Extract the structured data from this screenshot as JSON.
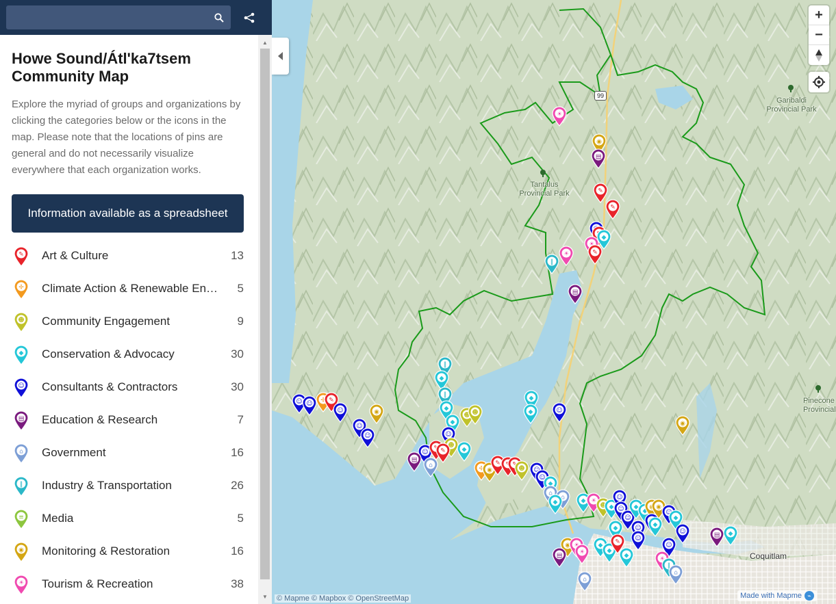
{
  "search": {
    "placeholder": "",
    "value": ""
  },
  "sidebar": {
    "title": "Howe Sound/Átl'ka7tsem Community Map",
    "description": "Explore the myriad of groups and organizations by clicking the categories below or the icons in the map. Please note that the locations of pins are general and do not necessarily visualize everywhere that each organization works.",
    "spreadsheet_button": "Information available as a spreadsheet",
    "categories": [
      {
        "label": "Art & Culture",
        "count": "13",
        "color": "#e8232a",
        "icon": "art-icon"
      },
      {
        "label": "Climate Action & Renewable Energy",
        "count": "5",
        "color": "#f39a1f",
        "icon": "windmill-icon"
      },
      {
        "label": "Community Engagement",
        "count": "9",
        "color": "#c0c22a",
        "icon": "people-icon"
      },
      {
        "label": "Conservation & Advocacy",
        "count": "30",
        "color": "#24c7d8",
        "icon": "fish-icon"
      },
      {
        "label": "Consultants & Contractors",
        "count": "30",
        "color": "#1010d8",
        "icon": "chat-person-icon"
      },
      {
        "label": "Education & Research",
        "count": "7",
        "color": "#7a1a7e",
        "icon": "book-icon"
      },
      {
        "label": "Government",
        "count": "16",
        "color": "#7d9fd6",
        "icon": "building-icon"
      },
      {
        "label": "Industry & Transportation",
        "count": "26",
        "color": "#2bb8c8",
        "icon": "road-icon"
      },
      {
        "label": "Media",
        "count": "5",
        "color": "#8dc63f",
        "icon": "newspaper-icon"
      },
      {
        "label": "Monitoring & Restoration",
        "count": "16",
        "color": "#d4a614",
        "icon": "monitor-icon"
      },
      {
        "label": "Tourism & Recreation",
        "count": "38",
        "color": "#f04ab0",
        "icon": "sunset-icon"
      }
    ]
  },
  "map": {
    "labels": {
      "tantalus": "Tantalus Provincial Park",
      "garibaldi": "Garibaldi Provincial Park",
      "pinecone": "Pinecone Provincial",
      "coquitlam": "Coquitlam",
      "highway": "99"
    },
    "attribution": "© Mapme © Mapbox © OpenStreetMap",
    "made_with": "Made with Mapme",
    "zoom_in": "+",
    "zoom_out": "−"
  }
}
